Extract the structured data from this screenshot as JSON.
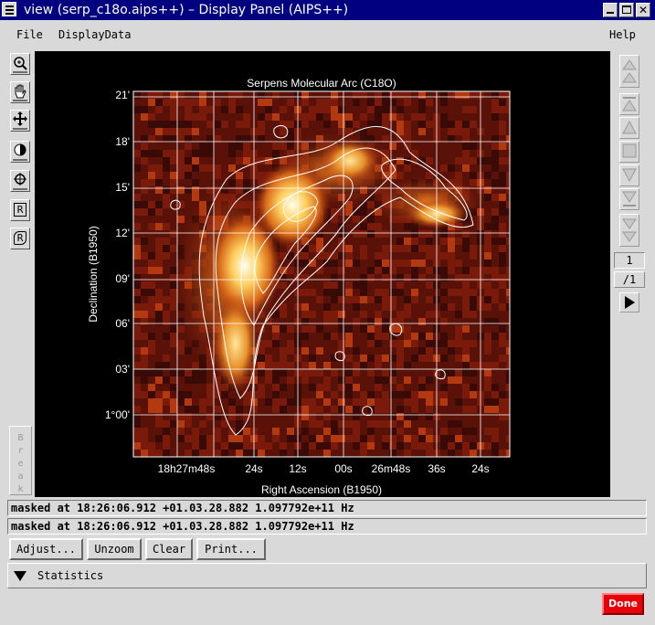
{
  "window": {
    "title": "view (serp_c18o.aips++) – Display Panel (AIPS++)"
  },
  "menubar": {
    "file": "File",
    "displaydata": "DisplayData",
    "help": "Help"
  },
  "toolbar": {
    "tools": [
      {
        "icon": "zoom-icon"
      },
      {
        "icon": "pan-hand-icon"
      },
      {
        "icon": "move-cross-icon"
      },
      {
        "icon": "colormap-contrast-icon"
      },
      {
        "icon": "position-crosshair-icon"
      },
      {
        "icon": "rectangle-region-icon",
        "label": "R"
      },
      {
        "icon": "polygon-region-icon",
        "label": "R"
      }
    ],
    "break_label": "Break"
  },
  "plot": {
    "title": "Serpens Molecular Arc (C18O)",
    "xlabel": "Right Ascension (B1950)",
    "ylabel": "Declination (B1950)",
    "x_ticks": [
      "18h27m48s",
      "24s",
      "12s",
      "00s",
      "26m48s",
      "36s",
      "24s"
    ],
    "y_ticks": [
      "21'",
      "18'",
      "15'",
      "12'",
      "09'",
      "06'",
      "03'",
      "1°00'"
    ],
    "colormap": [
      "#3a0a06",
      "#7a1a0a",
      "#b33a10",
      "#e07a20",
      "#ffd070",
      "#ffffe8"
    ],
    "contour_color": "#ffffff",
    "grid_color": "#ffffff"
  },
  "animator": {
    "frame": "1",
    "of_frames": "/1"
  },
  "status": {
    "line1": "masked at 18:26:06.912 +01.03.28.882 1.097792e+11 Hz",
    "line2": "masked at 18:26:06.912 +01.03.28.882 1.097792e+11 Hz"
  },
  "buttons": {
    "adjust": "Adjust...",
    "unzoom": "Unzoom",
    "clear": "Clear",
    "print": "Print...",
    "done": "Done"
  },
  "statistics": {
    "label": "Statistics"
  }
}
